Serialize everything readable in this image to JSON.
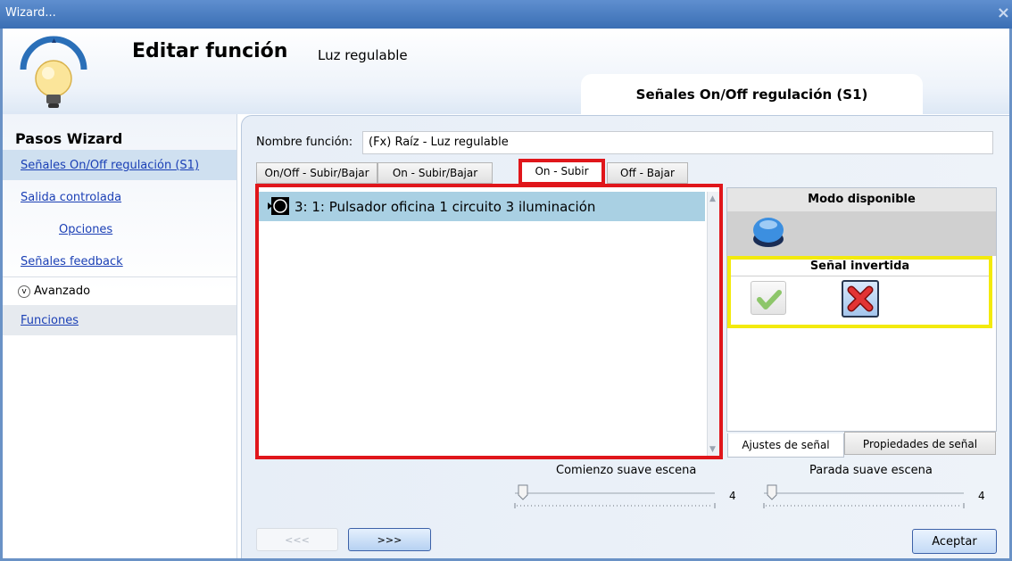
{
  "window": {
    "title": "Wizard...",
    "close_glyph": "×"
  },
  "header": {
    "title": "Editar función",
    "subtitle": "Luz regulable",
    "current_step": "Señales On/Off regulación (S1)",
    "icon": "light-bulb-icon"
  },
  "sidebar": {
    "heading": "Pasos Wizard",
    "items": [
      {
        "label": "Señales On/Off regulación (S1)",
        "selected": true
      },
      {
        "label": "Salida controlada"
      },
      {
        "label": "Opciones"
      },
      {
        "label": "Señales feedback"
      },
      {
        "label": "Avanzado",
        "expander": true
      },
      {
        "label": "Funciones"
      }
    ]
  },
  "form": {
    "name_label": "Nombre función:",
    "name_value": "(Fx) Raíz - Luz regulable"
  },
  "tabs": [
    {
      "label": "On/Off - Subir/Bajar"
    },
    {
      "label": "On - Subir/Bajar"
    },
    {
      "label": "On - Subir",
      "active": true
    },
    {
      "label": "Off - Bajar"
    }
  ],
  "list": {
    "items": [
      {
        "label": "3: 1: Pulsador oficina 1 circuito 3 iluminación",
        "icon": "pushbutton-icon"
      }
    ]
  },
  "mode_panel": {
    "title": "Modo disponible",
    "button_icon": "blue-pushbutton-icon"
  },
  "inverted_signal": {
    "title": "Señal invertida",
    "yes_icon": "checkmark-icon",
    "no_icon": "red-x-icon"
  },
  "signal_tabs": [
    {
      "label": "Ajustes de señal"
    },
    {
      "label": "Propiedades de señal"
    }
  ],
  "sliders": [
    {
      "label": "Comienzo suave escena",
      "value": "4"
    },
    {
      "label": "Parada suave escena",
      "value": "4"
    }
  ],
  "buttons": {
    "prev": "<<<",
    "next": ">>>",
    "accept": "Aceptar"
  },
  "colors": {
    "highlight_red": "#e0161b",
    "highlight_yellow": "#f3ea0c",
    "selection_blue": "#a9d0e3"
  }
}
